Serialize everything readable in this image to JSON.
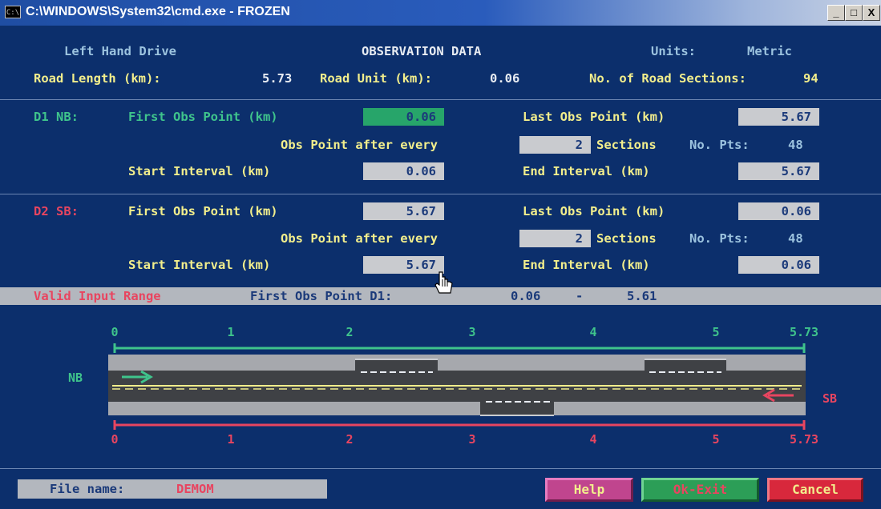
{
  "window": {
    "title": "C:\\WINDOWS\\System32\\cmd.exe - FROZEN",
    "icon": "C:\\",
    "min_icon": "_",
    "max_icon": "□",
    "close_icon": "X"
  },
  "header": {
    "drive": "Left Hand Drive",
    "title": "OBSERVATION DATA",
    "units_label": "Units:",
    "units_value": "Metric"
  },
  "road": {
    "length_label": "Road Length (km):",
    "length_value": "5.73",
    "unit_label": "Road Unit (km):",
    "unit_value": "0.06",
    "sections_label": "No. of Road Sections:",
    "sections_value": "94"
  },
  "d1": {
    "name": "D1 NB:",
    "first_label": "First Obs Point (km)",
    "first_value": "0.06",
    "last_label": "Last Obs Point (km)",
    "last_value": "5.67",
    "every_label": "Obs Point after every",
    "every_value": "2",
    "sections_label": "Sections",
    "pts_label": "No. Pts:",
    "pts_value": "48",
    "start_label": "Start Interval  (km)",
    "start_value": "0.06",
    "end_label": "End Interval   (km)",
    "end_value": "5.67"
  },
  "d2": {
    "name": "D2 SB:",
    "first_label": "First Obs Point (km)",
    "first_value": "5.67",
    "last_label": "Last Obs Point (km)",
    "last_value": "0.06",
    "every_label": "Obs Point after every",
    "every_value": "2",
    "sections_label": "Sections",
    "pts_label": "No. Pts:",
    "pts_value": "48",
    "start_label": "Start Interval  (km)",
    "start_value": "5.67",
    "end_label": "End Interval   (km)",
    "end_value": "0.06"
  },
  "valid": {
    "label": "Valid Input Range",
    "field": "First Obs Point D1:",
    "min": "0.06",
    "dash": "-",
    "max": "5.61"
  },
  "diagram": {
    "top_ticks": [
      "0",
      "1",
      "2",
      "3",
      "4",
      "5",
      "5.73"
    ],
    "bottom_ticks": [
      "0",
      "1",
      "2",
      "3",
      "4",
      "5",
      "5.73"
    ],
    "nb_label": "NB",
    "sb_label": "SB",
    "colors": {
      "nb": "#3fc48c",
      "sb": "#e84560",
      "road": "#a6a8ad",
      "lane": "#404246"
    }
  },
  "footer": {
    "file_label": "File name:",
    "file_value": "DEMOM",
    "help": "Help",
    "ok": "Ok-Exit",
    "cancel": "Cancel"
  }
}
